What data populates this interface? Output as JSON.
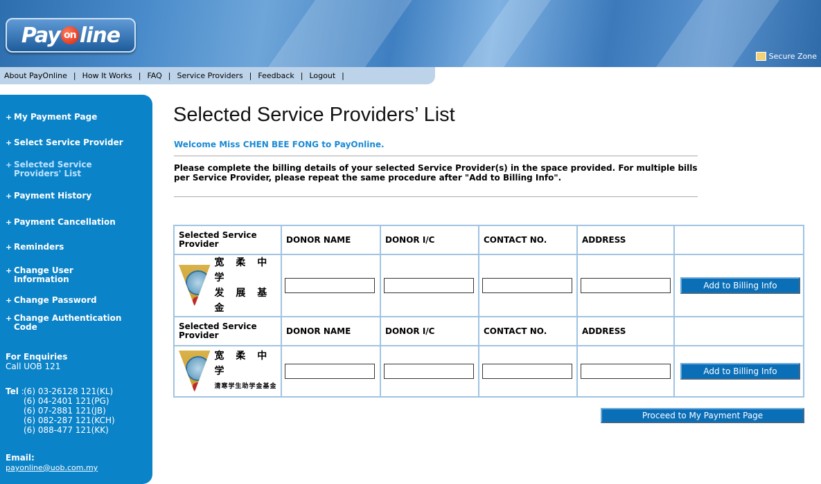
{
  "header": {
    "logo_left": "Pay",
    "logo_on": "on",
    "logo_right": "line",
    "secure_zone": "Secure Zone"
  },
  "topnav": {
    "items": [
      "About PayOnline",
      "How It Works",
      "FAQ",
      "Service Providers",
      "Feedback",
      "Logout"
    ]
  },
  "sidebar": {
    "items": [
      "My Payment Page",
      "Select Service Provider",
      "Selected Service Providers' List",
      "Payment History",
      "Payment Cancellation",
      "Reminders",
      "Change User Information",
      "Change Password",
      "Change Authentication Code"
    ],
    "active_index": 2,
    "enquiries_title": "For Enquiries",
    "enquiries_line": "Call UOB 121",
    "tel_label": "Tel",
    "tel_numbers": [
      "(6) 03-26128 121(KL)",
      "(6) 04-2401 121(PG)",
      "(6) 07-2881 121(JB)",
      "(6) 082-287 121(KCH)",
      "(6) 088-477 121(KK)"
    ],
    "email_label": "Email:",
    "email": "payonline@uob.com.my"
  },
  "main": {
    "title": "Selected Service Providers’ List",
    "welcome": "Welcome Miss CHEN BEE FONG to PayOnline.",
    "instructions": "Please complete the billing details of your selected Service Provider(s) in the space provided. For multiple bills per Service Provider, please repeat the same procedure after \"Add to Billing Info\".",
    "table_headers": {
      "provider": "Selected Service Provider",
      "donor_name": "DONOR NAME",
      "donor_ic": "DONOR I/C",
      "contact": "CONTACT NO.",
      "address": "ADDRESS"
    },
    "providers": [
      {
        "logo_text_top": "宽 柔 中 学",
        "logo_text_bottom": "发 展 基 金",
        "logo_small": false
      },
      {
        "logo_text_top": "宽 柔 中 学",
        "logo_text_bottom": "清寒学生助学金基金",
        "logo_small": true
      }
    ],
    "add_button": "Add to Billing Info",
    "proceed_button": "Proceed to My Payment Page"
  }
}
